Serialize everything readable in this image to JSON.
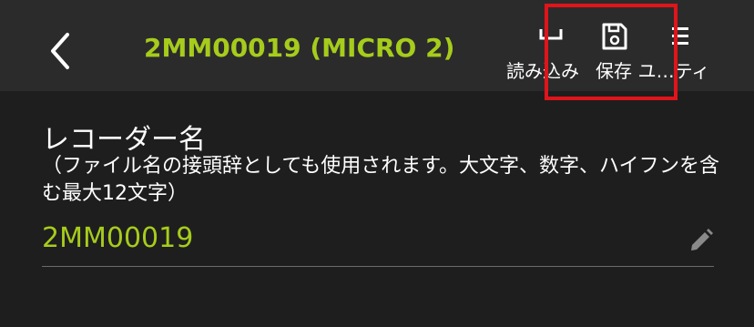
{
  "header": {
    "title": "2MM00019 (MICRO 2)",
    "back_icon": "chevron-left-icon",
    "tools": {
      "load_label": "読み込み",
      "save_label": "保存",
      "util_label": "ユ…ティ"
    }
  },
  "form": {
    "section_label": "レコーダー名",
    "help_text": "（ファイル名の接頭辞としても使用されます。大文字、数字、ハイフンを含む最大12文字）",
    "recorder_name_value": "2MM00019"
  },
  "colors": {
    "accent": "#a6cc1c",
    "highlight": "#e0141b",
    "background": "#1e1e1e",
    "header_background": "#2b2b2b"
  }
}
